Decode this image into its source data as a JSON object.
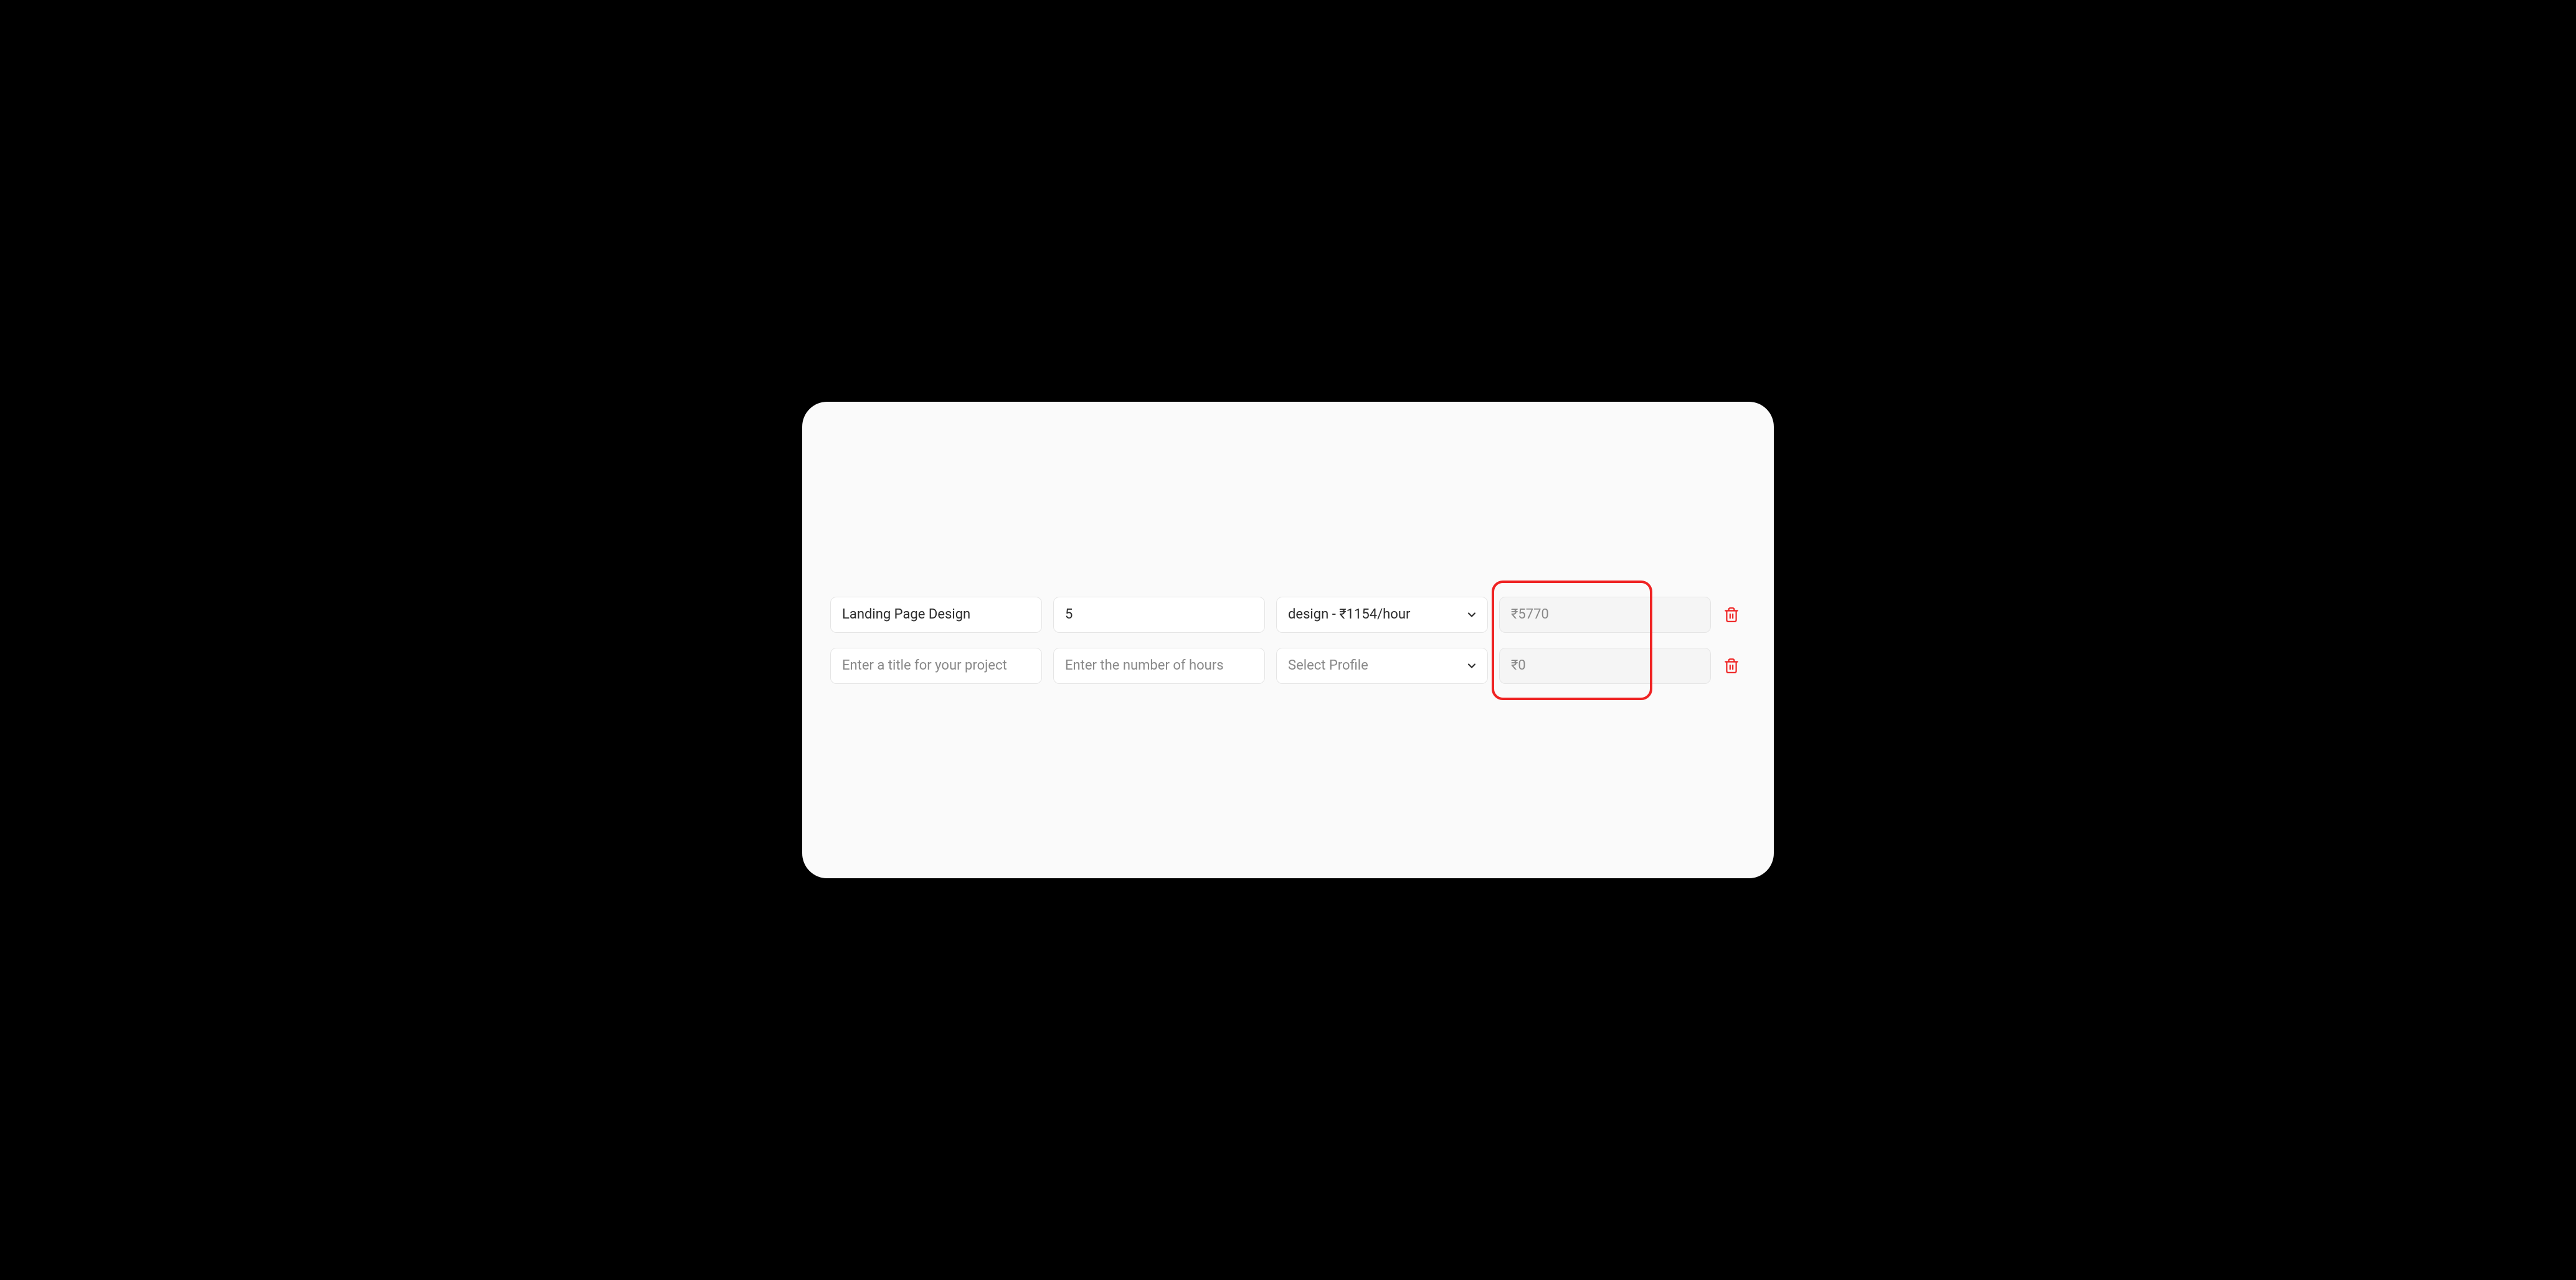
{
  "placeholders": {
    "title": "Enter a title for your project",
    "hours": "Enter the number of hours",
    "profile": "Select Profile"
  },
  "rows": [
    {
      "title": "Landing Page Design",
      "hours": "5",
      "profile": "design - ₹1154/hour",
      "amount": "₹5770"
    },
    {
      "title": "",
      "hours": "",
      "profile": "",
      "amount": "₹0"
    }
  ],
  "colors": {
    "danger": "#ef2323"
  },
  "highlight": {
    "target": "amount-column"
  }
}
